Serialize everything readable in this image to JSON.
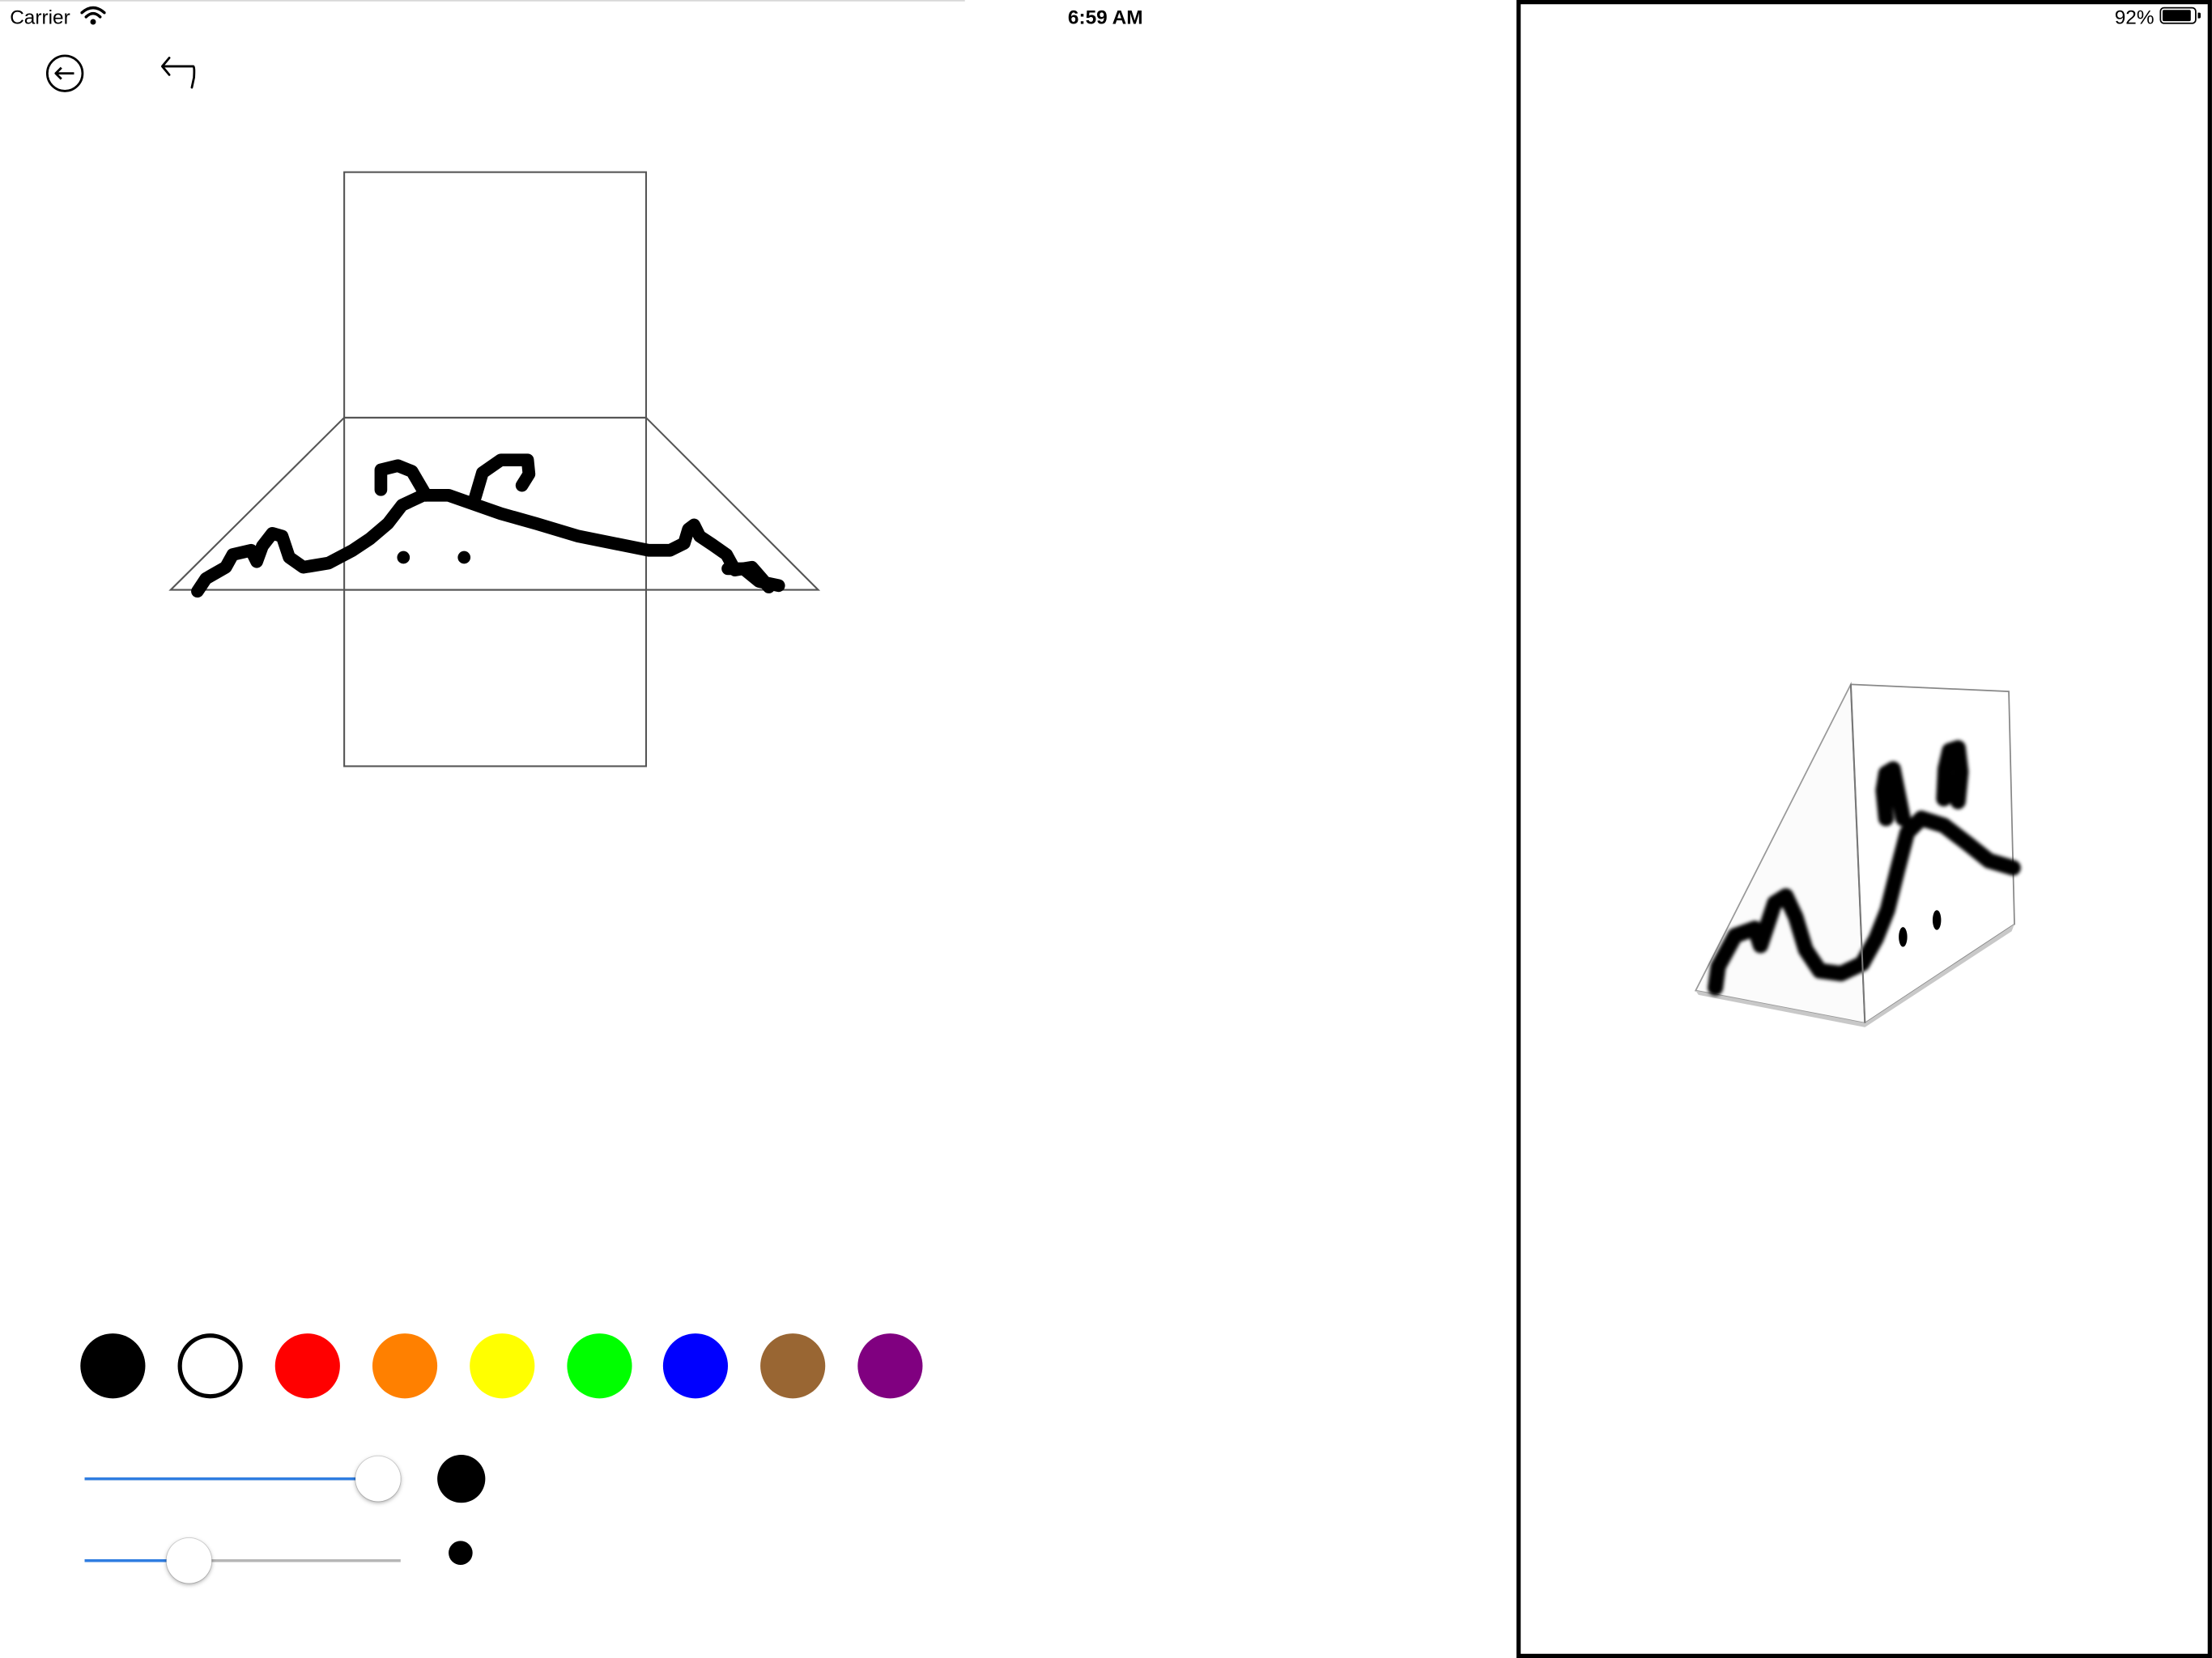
{
  "status_bar": {
    "carrier": "Carrier",
    "time": "6:59 AM",
    "battery_percent": "92%",
    "battery_level": 0.92
  },
  "toolbar": {
    "back_icon": "circle-arrow-left-icon",
    "undo_icon": "undo-arrow-icon"
  },
  "editor": {
    "net_outline": "triangular-prism-net",
    "drawing_color": "#000000"
  },
  "palette": {
    "colors": [
      {
        "name": "black",
        "hex": "#000000"
      },
      {
        "name": "white",
        "hex": "#ffffff"
      },
      {
        "name": "red",
        "hex": "#ff0000"
      },
      {
        "name": "orange",
        "hex": "#ff8000"
      },
      {
        "name": "yellow",
        "hex": "#ffff00"
      },
      {
        "name": "green",
        "hex": "#00ff00"
      },
      {
        "name": "blue",
        "hex": "#0000ff"
      },
      {
        "name": "brown",
        "hex": "#996633"
      },
      {
        "name": "purple",
        "hex": "#800080"
      }
    ],
    "selected": "black"
  },
  "sliders": {
    "brush_size": {
      "value": 0.93,
      "accent": "#2f7de1"
    },
    "second": {
      "value": 0.33,
      "accent": "#2f7de1"
    }
  },
  "preview_3d": {
    "shape": "triangular-prism",
    "border_color": "#000000"
  }
}
